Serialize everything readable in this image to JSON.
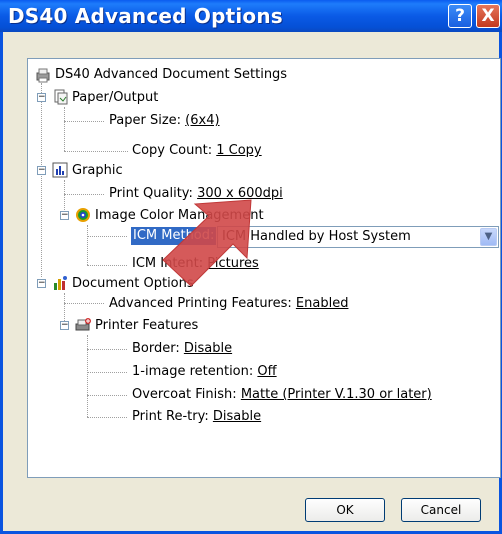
{
  "window": {
    "title": "DS40 Advanced Options",
    "help_label": "?",
    "close_label": "X"
  },
  "tree": {
    "root": "DS40 Advanced Document Settings",
    "paper_output": "Paper/Output",
    "paper_size_label": "Paper Size:",
    "paper_size_value": "(6x4)",
    "copy_count_label": "Copy Count:",
    "copy_count_value": "1 Copy",
    "graphic": "Graphic",
    "print_quality_label": "Print Quality:",
    "print_quality_value": "300 x 600dpi",
    "icm": "Image Color Management",
    "icm_method_label": "ICM Method:",
    "icm_intent_label": "ICM Intent:",
    "icm_intent_value": "Pictures",
    "document_options": "Document Options",
    "advanced_features_label": "Advanced Printing Features:",
    "advanced_features_value": "Enabled",
    "printer_features": "Printer Features",
    "border_label": "Border:",
    "border_value": "Disable",
    "retention_label": "1-image retention:",
    "retention_value": "Off",
    "overcoat_label": "Overcoat Finish:",
    "overcoat_value": "Matte (Printer V.1.30 or later)",
    "retry_label": "Print Re-try:",
    "retry_value": "Disable"
  },
  "icm_method_dropdown": {
    "selected": "ICM Handled by Host System"
  },
  "buttons": {
    "ok": "OK",
    "cancel": "Cancel"
  },
  "colors": {
    "titlebar": "#0a5ae6",
    "selection": "#316ac5",
    "annotation_arrow": "#d04848"
  }
}
